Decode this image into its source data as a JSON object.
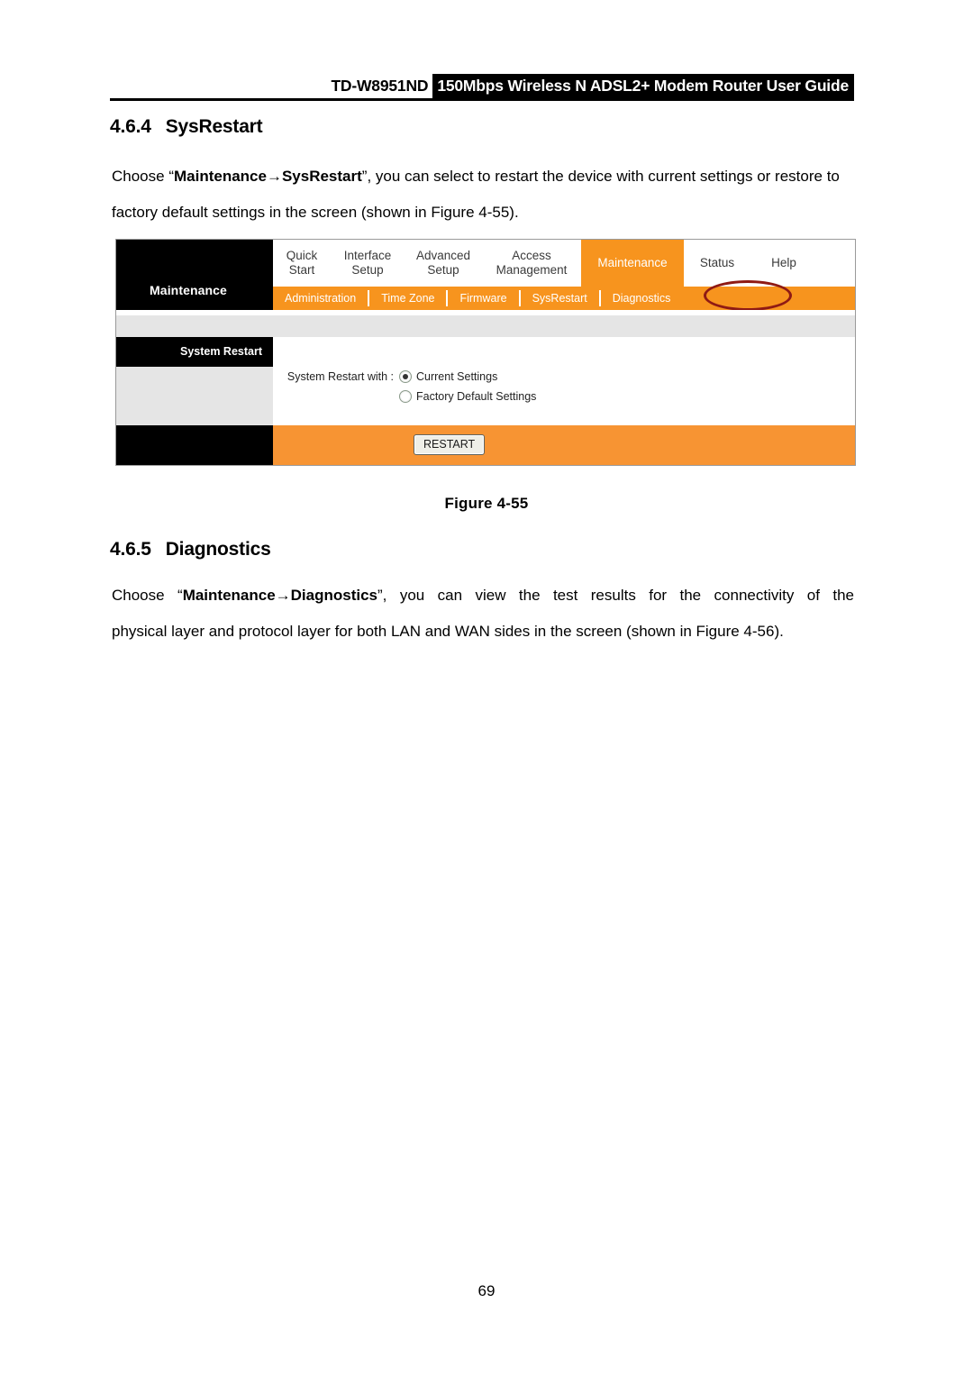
{
  "document": {
    "header": {
      "model": "TD-W8951ND",
      "title": "150Mbps Wireless N ADSL2+ Modem Router User Guide"
    },
    "page_number": "69"
  },
  "sections": [
    {
      "number": "4.6.4",
      "title": "SysRestart",
      "paragraph_prefix": "Choose “",
      "paragraph_bold": "Maintenance→SysRestart",
      "paragraph_suffix": "”, you can select to restart the device with current settings or restore to factory default settings in the screen (shown in Figure 4-55)."
    },
    {
      "number": "4.6.5",
      "title": "Diagnostics",
      "paragraph_prefix": "Choose “",
      "paragraph_bold": "Maintenance→Diagnostics",
      "paragraph_suffix": "”, you can view the test results for the connectivity of the",
      "paragraph_line2": "physical layer and protocol layer for both LAN and WAN sides in the screen (shown in Figure 4-56)."
    }
  ],
  "figure": {
    "caption": "Figure 4-55"
  },
  "router_ui": {
    "brand_panel_label": "Maintenance",
    "main_nav": [
      {
        "line1": "Quick",
        "line2": "Start",
        "active": false
      },
      {
        "line1": "Interface",
        "line2": "Setup",
        "active": false
      },
      {
        "line1": "Advanced",
        "line2": "Setup",
        "active": false
      },
      {
        "line1": "Access",
        "line2": "Management",
        "active": false
      },
      {
        "line1": "Maintenance",
        "line2": "",
        "active": true
      },
      {
        "line1": "Status",
        "line2": "",
        "active": false
      },
      {
        "line1": "Help",
        "line2": "",
        "active": false
      }
    ],
    "sub_nav": [
      {
        "label": "Administration",
        "highlighted": false
      },
      {
        "label": "Time Zone",
        "highlighted": false
      },
      {
        "label": "Firmware",
        "highlighted": false
      },
      {
        "label": "SysRestart",
        "highlighted": true
      },
      {
        "label": "Diagnostics",
        "highlighted": false
      }
    ],
    "sidebar": {
      "section_title": "System Restart"
    },
    "form": {
      "label": "System Restart with :",
      "options": [
        {
          "label": "Current Settings",
          "selected": true
        },
        {
          "label": "Factory Default Settings",
          "selected": false
        }
      ]
    },
    "footer": {
      "restart_button": "RESTART"
    },
    "colors": {
      "accent_orange": "#F7941E",
      "footer_orange": "#F79433",
      "annotation_red": "#8F1A14",
      "panel_gray": "#E5E5E5",
      "panel_black": "#000000"
    }
  }
}
